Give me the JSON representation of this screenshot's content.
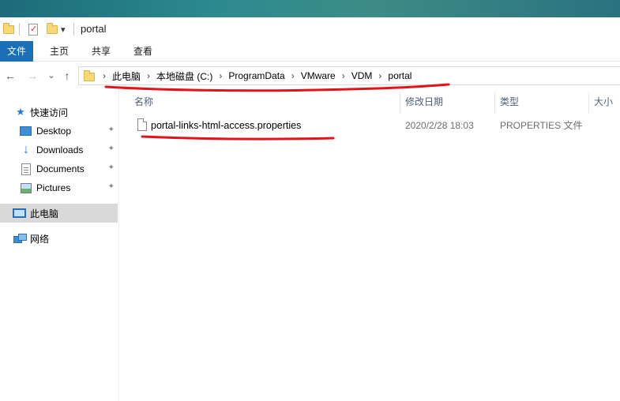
{
  "window": {
    "title": "portal"
  },
  "quick_access_toolbar": {
    "items": [
      {
        "icon": "folder-icon"
      },
      {
        "icon": "properties-check-icon"
      },
      {
        "icon": "new-folder-icon"
      },
      {
        "icon": "dropdown-arrow-icon",
        "glyph": "▾"
      }
    ]
  },
  "ribbon": {
    "tabs": [
      "文件",
      "主页",
      "共享",
      "查看"
    ]
  },
  "nav": {
    "back": "←",
    "forward": "→",
    "recent": "⌄",
    "up": "↑"
  },
  "address": {
    "crumbs": [
      "此电脑",
      "本地磁盘 (C:)",
      "ProgramData",
      "VMware",
      "VDM",
      "portal"
    ],
    "separator": "›"
  },
  "sidebar": {
    "quick_access": {
      "label": "快速访问",
      "icon": "star-icon"
    },
    "pinned": [
      {
        "label": "Desktop",
        "icon": "desktop-icon"
      },
      {
        "label": "Downloads",
        "icon": "downloads-icon"
      },
      {
        "label": "Documents",
        "icon": "documents-icon"
      },
      {
        "label": "Pictures",
        "icon": "pictures-icon"
      }
    ],
    "this_pc": {
      "label": "此电脑",
      "icon": "computer-icon",
      "selected": true
    },
    "network": {
      "label": "网络",
      "icon": "network-icon"
    },
    "pin_glyph": "✦"
  },
  "columns": {
    "name": "名称",
    "modified": "修改日期",
    "type": "类型",
    "size": "大小"
  },
  "files": [
    {
      "name": "portal-links-html-access.properties",
      "modified": "2020/2/28 18:03",
      "type": "PROPERTIES 文件",
      "icon": "file-icon"
    }
  ],
  "colors": {
    "accent": "#1a6fb7",
    "annotation": "#e0141a",
    "selected_bg": "#d9d9d9"
  }
}
